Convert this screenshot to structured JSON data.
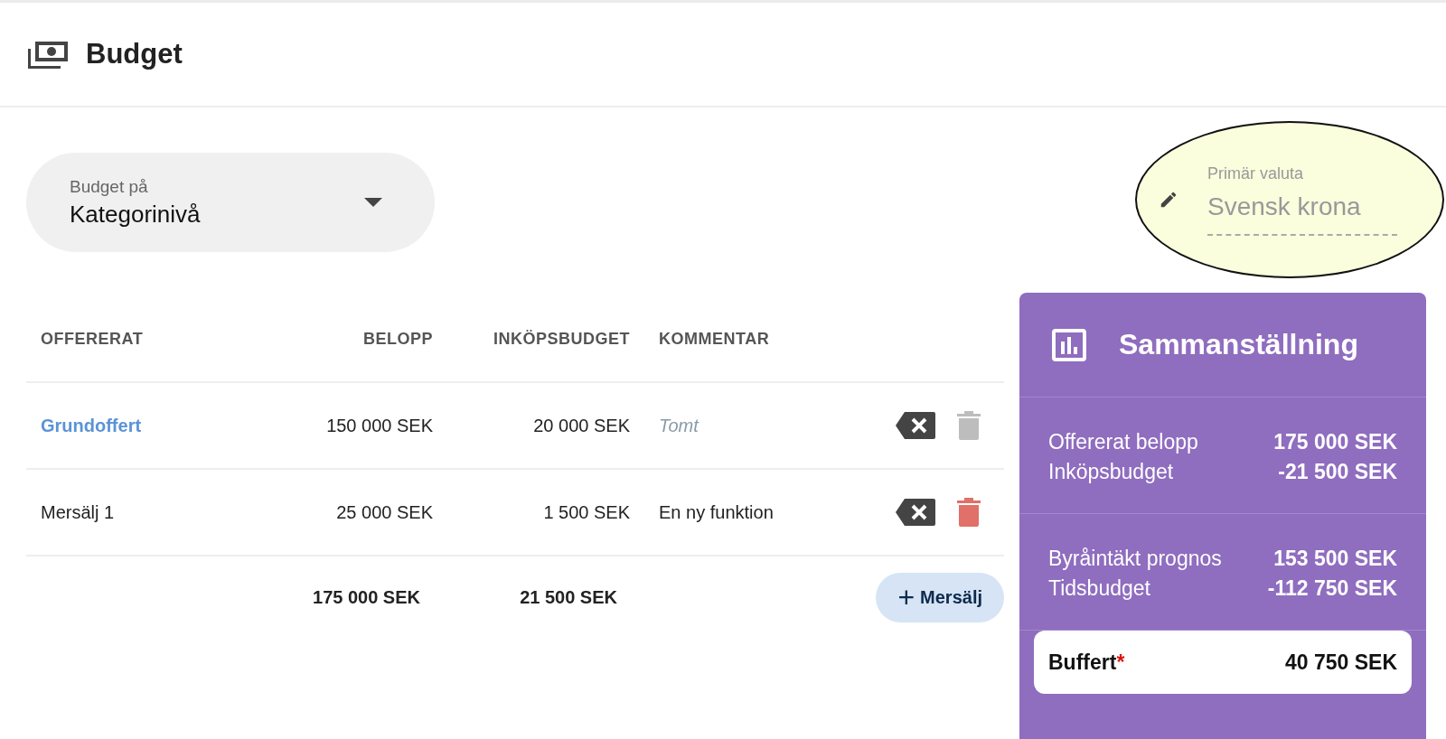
{
  "header": {
    "title": "Budget"
  },
  "budget_level": {
    "label": "Budget på",
    "value": "Kategorinivå"
  },
  "currency": {
    "label": "Primär valuta",
    "value": "Svensk krona",
    "highlighted": true
  },
  "table": {
    "columns": [
      "OFFERERAT",
      "BELOPP",
      "INKÖPSBUDGET",
      "KOMMENTAR"
    ],
    "rows": [
      {
        "name": "Grundoffert",
        "link": true,
        "amount": "150 000 SEK",
        "purchase_budget": "20 000 SEK",
        "comment": "Tomt",
        "comment_empty": true,
        "delete_disabled": true
      },
      {
        "name": "Mersälj 1",
        "link": false,
        "amount": "25 000 SEK",
        "purchase_budget": "1 500 SEK",
        "comment": "En ny funktion",
        "comment_empty": false,
        "delete_disabled": false
      }
    ],
    "totals": {
      "amount": "175 000 SEK",
      "purchase_budget": "21 500 SEK"
    },
    "add_button": {
      "icon": "+",
      "label": "Mersälj"
    }
  },
  "summary": {
    "title": "Sammanställning",
    "groups": [
      [
        {
          "label": "Offererat belopp",
          "value": "175 000 SEK"
        },
        {
          "label": "Inköpsbudget",
          "value": "-21 500 SEK"
        }
      ],
      [
        {
          "label": "Byråintäkt prognos",
          "value": "153 500 SEK"
        },
        {
          "label": "Tidsbudget",
          "value": "-112 750 SEK"
        }
      ]
    ],
    "result": {
      "label": "Buffert",
      "mark": "*",
      "value": "40 750 SEK"
    }
  }
}
